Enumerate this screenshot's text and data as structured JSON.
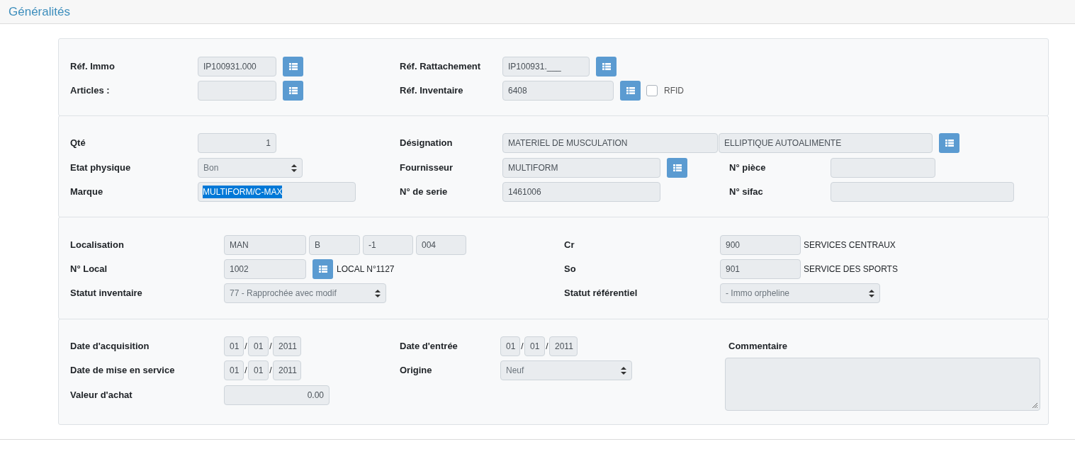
{
  "page_title": "Généralités",
  "identification": {
    "ref_immo": {
      "label": "Réf. Immo",
      "value": "IP100931.000"
    },
    "articles": {
      "label": "Articles :"
    },
    "ref_rattachement": {
      "label": "Réf. Rattachement",
      "value": "IP100931.___"
    },
    "ref_inventaire": {
      "label": "Réf. Inventaire",
      "value": "6408"
    },
    "rfid": {
      "label": "RFID",
      "checked": false
    }
  },
  "description": {
    "qte": {
      "label": "Qté",
      "value": "1"
    },
    "etat_physique": {
      "label": "Etat physique",
      "value": "Bon"
    },
    "marque": {
      "label": "Marque",
      "value": "MULTIFORM/C-MAX",
      "text_selected": true
    },
    "designation": {
      "label": "Désignation",
      "values": [
        "MATERIEL DE MUSCULATION",
        "ELLIPTIQUE AUTOALIMENTE"
      ]
    },
    "fournisseur": {
      "label": "Fournisseur",
      "value": "MULTIFORM"
    },
    "numero_serie": {
      "label": "N° de serie",
      "value": "1461006"
    },
    "numero_piece": {
      "label": "N° pièce"
    },
    "numero_sifac": {
      "label": "N° sifac"
    }
  },
  "location": {
    "localisation": {
      "label": "Localisation",
      "values": [
        "MAN",
        "B",
        "-1",
        "004"
      ]
    },
    "numero_local": {
      "label": "N° Local",
      "value": "1002",
      "description": "LOCAL N°1127"
    },
    "statut_inventaire": {
      "label": "Statut inventaire",
      "value": "77 - Rapprochée avec modif"
    },
    "cr": {
      "label": "Cr",
      "value": "900",
      "description": "SERVICES CENTRAUX"
    },
    "so": {
      "label": "So",
      "value": "901",
      "description": "SERVICE DES SPORTS"
    },
    "statut_referentiel": {
      "label": "Statut référentiel",
      "value": "- Immo orpheline"
    }
  },
  "dates": {
    "date_acquisition": {
      "label": "Date d'acquisition",
      "day": "01",
      "month": "01",
      "year": "2011",
      "separators": [
        "/",
        "/"
      ]
    },
    "date_mise_en_service": {
      "label": "Date de mise en service",
      "day": "01",
      "month": "01",
      "year": "2011",
      "separators": [
        "/",
        "/"
      ]
    },
    "valeur_achat": {
      "label": "Valeur d'achat",
      "value": "0.00"
    },
    "date_entree": {
      "label": "Date d'entrée",
      "day": "01",
      "month": "01",
      "year": "2011",
      "separators": [
        "/",
        "/"
      ]
    },
    "origine": {
      "label": "Origine",
      "value": "Neuf"
    },
    "commentaire": {
      "label": "Commentaire"
    }
  }
}
